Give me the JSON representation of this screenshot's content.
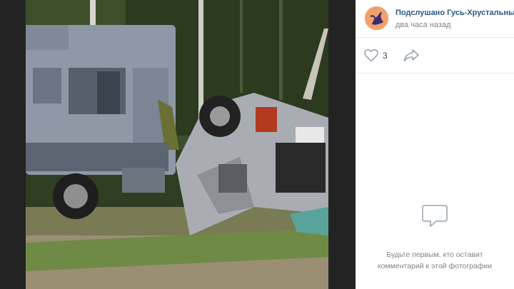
{
  "photo": {
    "description_icon": "photo-of-accident"
  },
  "post": {
    "author_name": "Подслушано Гусь-Хрустальный [",
    "time": "два часа назад",
    "likes": "3"
  },
  "comments": {
    "empty_line1": "Будьте первым, кто оставит",
    "empty_line2": "комментарий к этой фотографии"
  },
  "colors": {
    "link": "#2a5885",
    "muted": "#828282",
    "icon": "#99a2ad",
    "empty_icon": "#aeb7c2"
  }
}
